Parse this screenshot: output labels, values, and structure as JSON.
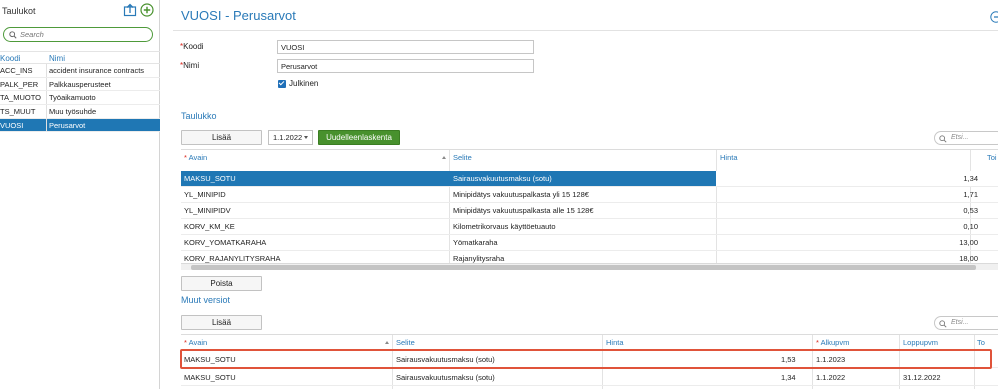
{
  "sidebar": {
    "title": "Taulukot",
    "search_placeholder": "Search",
    "col_code": "Koodi",
    "col_name": "Nimi",
    "items": [
      {
        "code": "ACC_INS",
        "name": "accident insurance contracts"
      },
      {
        "code": "PALK_PER",
        "name": "Palkkausperusteet"
      },
      {
        "code": "TA_MUOTO",
        "name": "Työaikamuoto"
      },
      {
        "code": "TS_MUUT",
        "name": "Muu työsuhde"
      },
      {
        "code": "VUOSI",
        "name": "Perusarvot"
      }
    ],
    "selected_index": 4
  },
  "header": {
    "title": "VUOSI - Perusarvot"
  },
  "form": {
    "code_label": "Koodi",
    "code_value": "VUOSI",
    "name_label": "Nimi",
    "name_value": "Perusarvot",
    "public_label": "Julkinen",
    "public_checked": true
  },
  "table_section": {
    "title": "Taulukko",
    "add_label": "Lisää",
    "date_value": "1.1.2022",
    "recalc_label": "Uudelleenlaskenta",
    "search_placeholder": "Etsi...",
    "columns": {
      "key": "Avain",
      "desc": "Selite",
      "price": "Hinta",
      "extra": "Toi"
    },
    "rows": [
      {
        "key": "MAKSU_SOTU",
        "desc": "Sairausvakuutusmaksu (sotu)",
        "price": "1,34"
      },
      {
        "key": "YL_MINIPID",
        "desc": "Minipidätys vakuutuspalkasta yli 15 128€",
        "price": "1,71"
      },
      {
        "key": "YL_MINIPIDV",
        "desc": "Minipidätys vakuutuspalkasta alle 15 128€",
        "price": "0,53"
      },
      {
        "key": "KORV_KM_KE",
        "desc": "Kilometrikorvaus käyttöetuauto",
        "price": "0,10"
      },
      {
        "key": "KORV_YOMATKARAHA",
        "desc": "Yömatkaraha",
        "price": "13,00"
      },
      {
        "key": "KORV_RAJANYLITYSRAHA",
        "desc": "Rajanylitysraha",
        "price": "18,00"
      }
    ],
    "delete_label": "Poista"
  },
  "versions_section": {
    "title": "Muut versiot",
    "add_label": "Lisää",
    "search_placeholder": "Etsi...",
    "columns": {
      "key": "Avain",
      "desc": "Selite",
      "price": "Hinta",
      "start": "Alkupvm",
      "end": "Loppupvm",
      "extra": "To"
    },
    "rows": [
      {
        "key": "MAKSU_SOTU",
        "desc": "Sairausvakuutusmaksu (sotu)",
        "price": "1,53",
        "start": "1.1.2023",
        "end": ""
      },
      {
        "key": "MAKSU_SOTU",
        "desc": "Sairausvakuutusmaksu (sotu)",
        "price": "1,34",
        "start": "1.1.2022",
        "end": "31.12.2022"
      }
    ]
  },
  "colors": {
    "accent": "#2a7ab8",
    "selection": "#1f77b4",
    "green_button": "#48912d",
    "required": "#d9261c",
    "highlight": "#e0533a"
  },
  "icons": [
    "upload-icon",
    "add-circle-icon",
    "search-icon",
    "sort-icon",
    "info-icon"
  ]
}
